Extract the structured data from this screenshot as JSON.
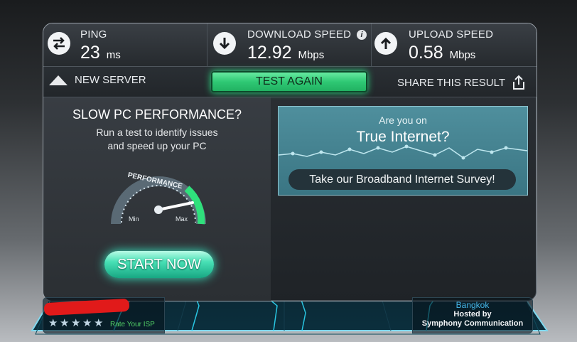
{
  "stats": {
    "ping": {
      "label": "PING",
      "value": "23",
      "unit": "ms"
    },
    "download": {
      "label": "DOWNLOAD SPEED",
      "value": "12.92",
      "unit": "Mbps"
    },
    "upload": {
      "label": "UPLOAD SPEED",
      "value": "0.58",
      "unit": "Mbps"
    },
    "info_glyph": "i"
  },
  "toolbar": {
    "new_server": "NEW SERVER",
    "test_again": "TEST AGAIN",
    "share": "SHARE THIS RESULT"
  },
  "promo": {
    "title": "SLOW PC PERFORMANCE?",
    "subtitle_line1": "Run a test to identify issues",
    "subtitle_line2": "and speed up your PC",
    "gauge_label": "PERFORMANCE",
    "gauge_min": "Min",
    "gauge_max": "Max",
    "start_now": "START NOW"
  },
  "ad": {
    "line1": "Are you on",
    "line2": "True Internet?",
    "survey_button": "Take our Broadband Internet Survey!"
  },
  "isp": {
    "rating": 5,
    "rate_label": "Rate Your ISP"
  },
  "host": {
    "city": "Bangkok",
    "hosted_by": "Hosted by",
    "provider": "Symphony Communication"
  },
  "colors": {
    "accent_green": "#2fc874",
    "accent_cyan": "#38e6c0",
    "city_blue": "#45b6e8",
    "redaction": "#e11a1a"
  }
}
